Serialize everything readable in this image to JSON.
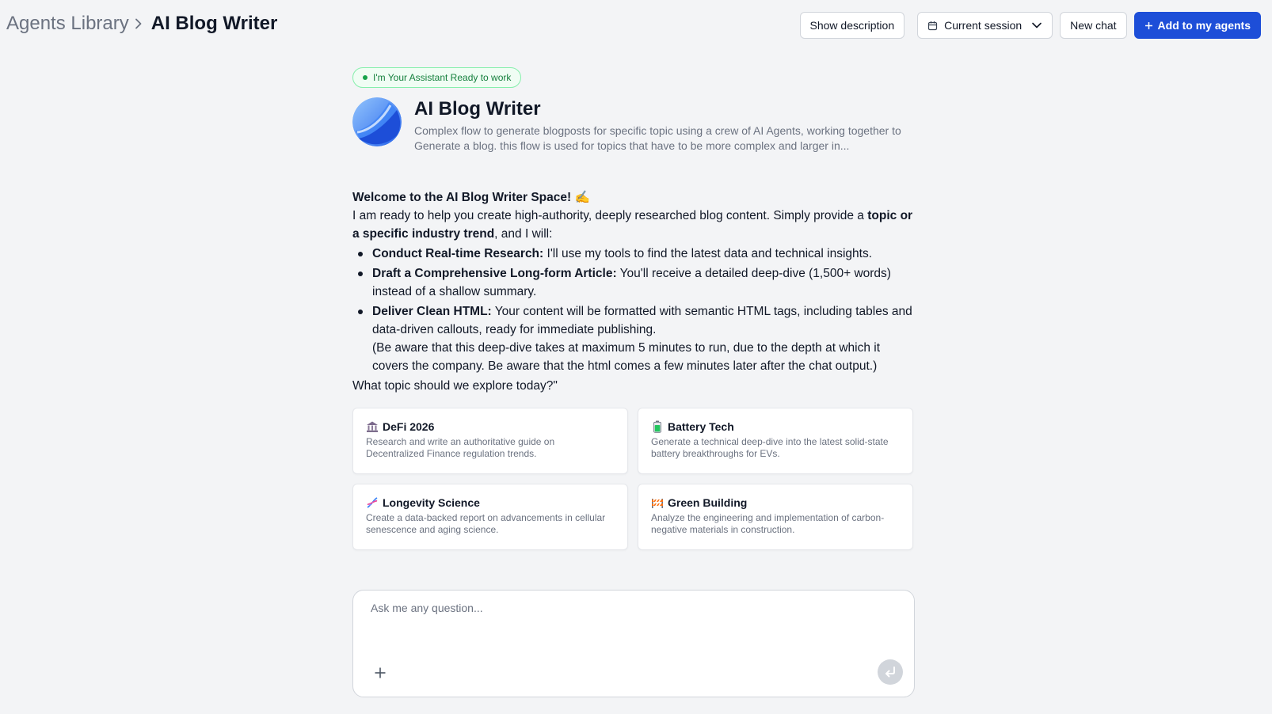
{
  "breadcrumb": {
    "root": "Agents Library",
    "current": "AI Blog Writer",
    "separator_icon": "chevron-right-icon"
  },
  "header_actions": {
    "show_description": "Show description",
    "session_select": {
      "selected": "Current session",
      "icon": "calendar-icon"
    },
    "new_chat": "New chat",
    "add_to_agents": "Add to my agents"
  },
  "status": {
    "text": "I'm Your Assistant Ready to work"
  },
  "agent": {
    "name": "AI Blog Writer",
    "description": "Complex flow to generate blogposts for specific topic using a crew of AI Agents, working together to Generate a blog. this flow is used for topics that have to be more complex and larger in..."
  },
  "welcome": {
    "title": "Welcome to the AI Blog Writer Space! ✍️",
    "intro_1": "I am ready to help you create high-authority, deeply researched blog content. Simply provide a ",
    "intro_bold": "topic or a specific industry trend",
    "intro_2": ", and I will:",
    "bullets": [
      {
        "bold": "Conduct Real-time Research:",
        "text": " I'll use my tools to find the latest data and technical insights."
      },
      {
        "bold": "Draft a Comprehensive Long-form Article:",
        "text": " You'll receive a detailed deep-dive (1,500+ words) instead of a shallow summary."
      },
      {
        "bold": "Deliver Clean HTML:",
        "text": " Your content will be formatted with semantic HTML tags, including tables and data-driven callouts, ready for immediate publishing."
      }
    ],
    "note": "(Be aware that this deep-dive takes at maximum 5 minutes to run, due to the depth at which it covers the company. Be aware that the html comes a few minutes later after the chat output.)",
    "question": "What topic should we explore today?\""
  },
  "suggestions": [
    {
      "icon": "bank-icon",
      "title": "DeFi 2026",
      "desc": "Research and write an authoritative guide on Decentralized Finance regulation trends."
    },
    {
      "icon": "battery-icon",
      "title": "Battery Tech",
      "desc": "Generate a technical deep-dive into the latest solid-state battery breakthroughs for EVs."
    },
    {
      "icon": "dna-icon",
      "title": "Longevity Science",
      "desc": "Create a data-backed report on advancements in cellular senescence and aging science."
    },
    {
      "icon": "construction-icon",
      "title": "Green Building",
      "desc": "Analyze the engineering and implementation of carbon-negative materials in construction."
    }
  ],
  "composer": {
    "placeholder": "Ask me any question...",
    "attach_icon": "plus-icon",
    "send_icon": "enter-icon"
  },
  "colors": {
    "primary": "#1d4ed8",
    "status_green": "#16a34a",
    "background": "#f3f4f6"
  }
}
